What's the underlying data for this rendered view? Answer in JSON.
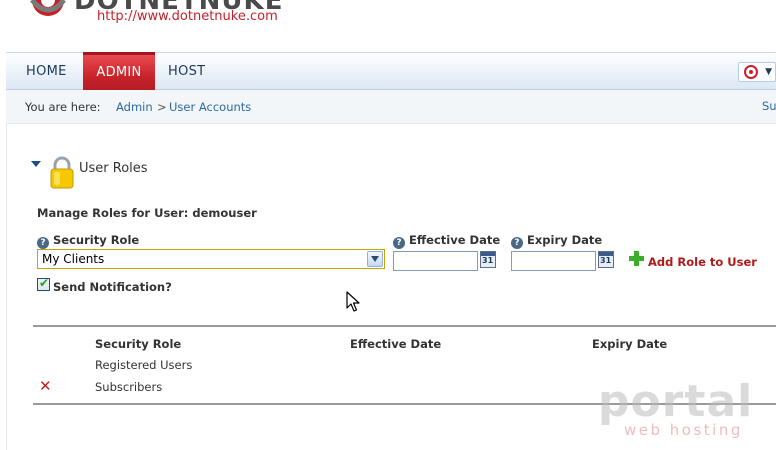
{
  "header": {
    "logo_text": "DOTNETNUKE",
    "logo_url": "http://www.dotnetnuke.com"
  },
  "nav": {
    "items": [
      {
        "label": "HOME",
        "active": false
      },
      {
        "label": "ADMIN",
        "active": true
      },
      {
        "label": "HOST",
        "active": false
      }
    ]
  },
  "breadcrumb": {
    "prefix": "You are here:",
    "items": [
      "Admin",
      "User Accounts"
    ],
    "separator": ">",
    "right_link": "Su"
  },
  "module": {
    "title": "User Roles",
    "manage_label": "Manage Roles for User: demouser",
    "security_role_label": "Security Role",
    "security_role_value": "My Clients",
    "effective_date_label": "Effective Date",
    "effective_date_value": "",
    "expiry_date_label": "Expiry Date",
    "expiry_date_value": "",
    "calendar_day": "31",
    "add_role_label": "Add Role to User",
    "send_notification_label": "Send Notification?",
    "send_notification_checked": true
  },
  "grid": {
    "columns": [
      "Security Role",
      "Effective Date",
      "Expiry Date"
    ],
    "rows": [
      {
        "role": "Registered Users",
        "effective": "",
        "expiry": "",
        "deletable": false
      },
      {
        "role": "Subscribers",
        "effective": "",
        "expiry": "",
        "deletable": true
      }
    ]
  },
  "watermark": {
    "brand": "portal",
    "tagline": "web hosting"
  },
  "colors": {
    "accent_red": "#c9232b",
    "link_blue": "#2c6a9e",
    "nav_text": "#1b3a5c"
  }
}
